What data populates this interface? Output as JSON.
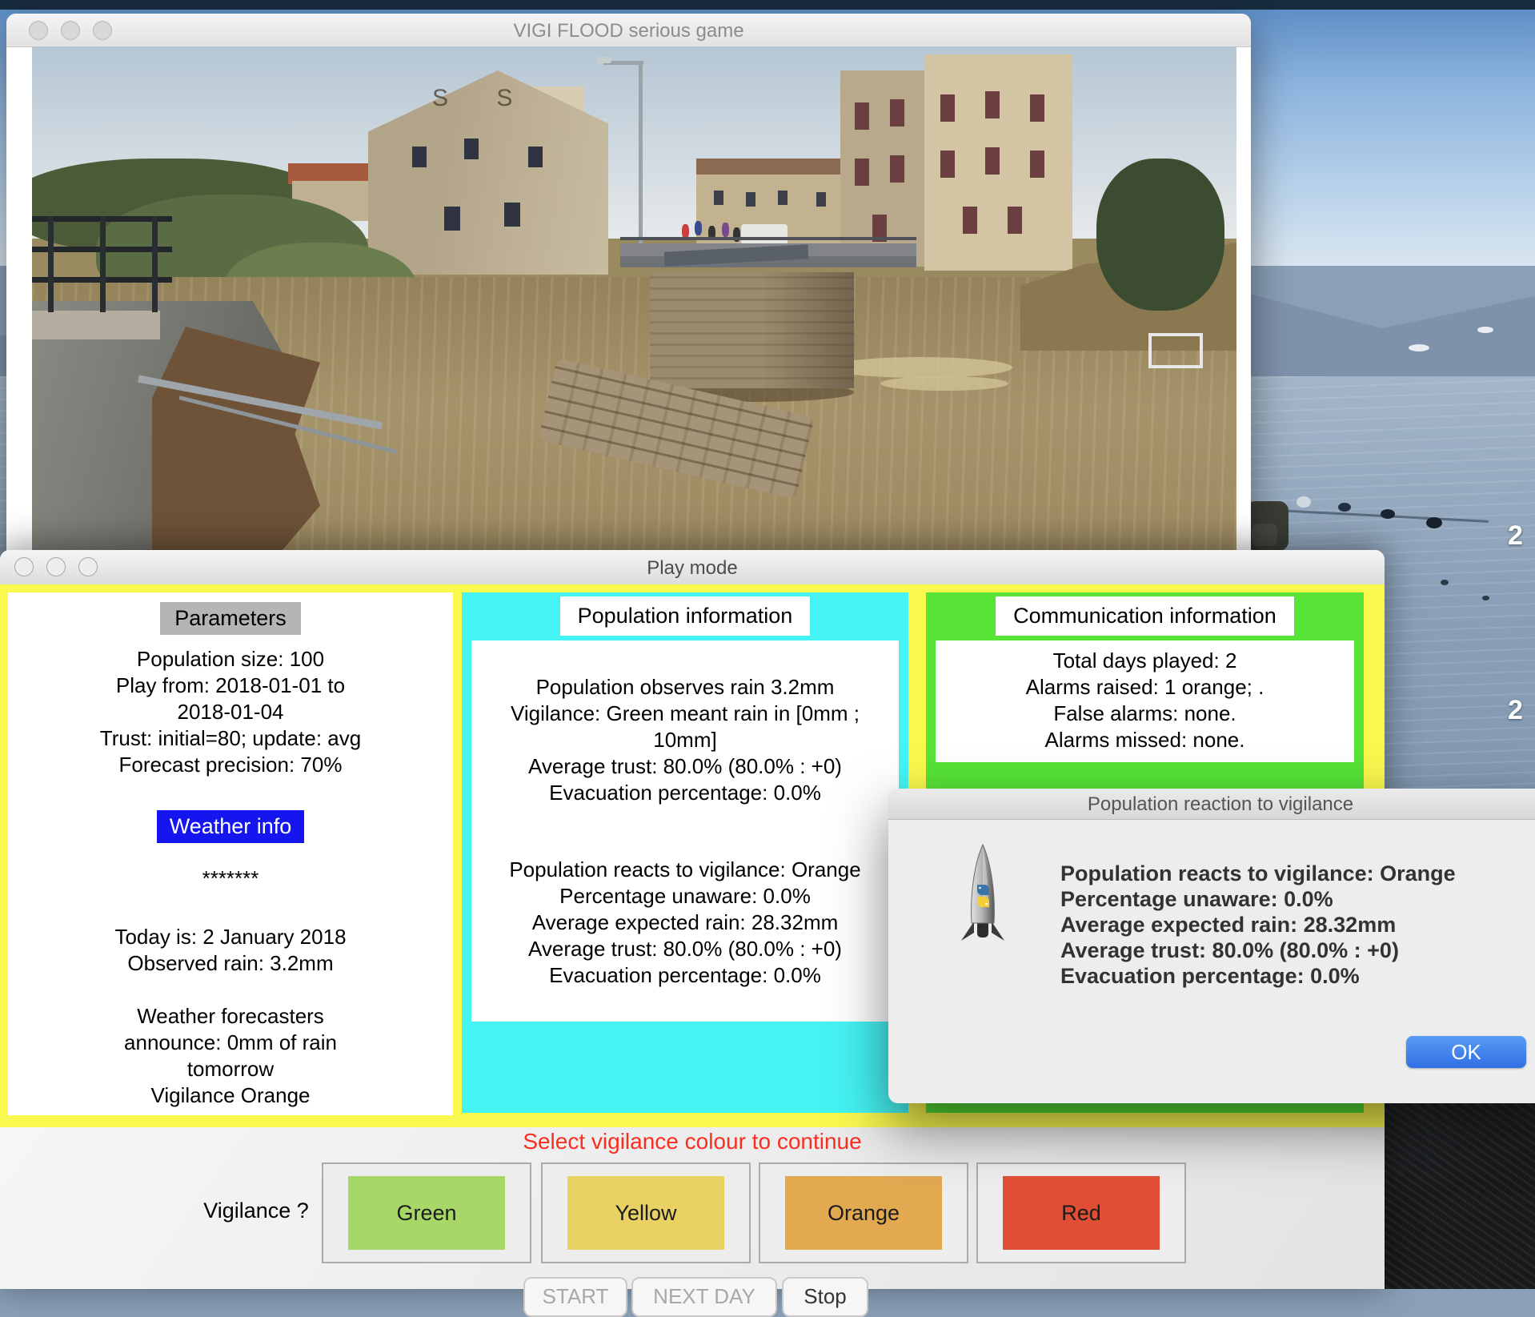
{
  "background": {
    "badge_top": "2",
    "badge_bottom": "2"
  },
  "main_window": {
    "title": "VIGI FLOOD serious game"
  },
  "play_window": {
    "title": "Play mode"
  },
  "parameters_panel": {
    "title": "Parameters",
    "line1": "Population size: 100",
    "line2": "Play from: 2018-01-01 to",
    "line3": "2018-01-04",
    "line4": "Trust: initial=80; update: avg",
    "line5": "Forecast precision: 70%",
    "weather_button": "Weather info",
    "stars": "*******",
    "line6": "Today is: 2 January 2018",
    "line7": "Observed rain: 3.2mm",
    "line8": "Weather forecasters",
    "line9": "announce:  0mm of rain",
    "line10": "tomorrow",
    "line11": "Vigilance Orange"
  },
  "population_panel": {
    "title": "Population information",
    "b1l1": "Population observes rain 3.2mm",
    "b1l2": "Vigilance: Green meant rain in [0mm ;",
    "b1l3": "10mm]",
    "b1l4": "Average trust: 80.0%  (80.0% : +0)",
    "b1l5": "Evacuation percentage: 0.0%",
    "b2l1": "Population reacts to vigilance: Orange",
    "b2l2": "Percentage unaware: 0.0%",
    "b2l3": "Average expected rain: 28.32mm",
    "b2l4": "Average trust: 80.0%  (80.0% : +0)",
    "b2l5": "Evacuation percentage: 0.0%"
  },
  "communication_panel": {
    "title": "Communication information",
    "line1": "Total days played: 2",
    "line2": "Alarms raised: 1 orange; .",
    "line3": "False alarms: none.",
    "line4": "Alarms missed: none."
  },
  "dialog": {
    "title": "Population reaction to vigilance",
    "line1": "Population reacts to vigilance: Orange",
    "line2": "Percentage unaware: 0.0%",
    "line3": "Average expected rain: 28.32mm",
    "line4": "Average trust: 80.0%  (80.0% : +0)",
    "line5": "Evacuation percentage: 0.0%",
    "ok_label": "OK"
  },
  "vigilance": {
    "prompt": "Select vigilance colour to continue",
    "question": "Vigilance ?",
    "green": {
      "label": "Green",
      "color": "#a7d766"
    },
    "yellow": {
      "label": "Yellow",
      "color": "#e9d163"
    },
    "orange": {
      "label": "Orange",
      "color": "#e2a951"
    },
    "red": {
      "label": "Red",
      "color": "#e04f35"
    }
  },
  "controls": {
    "start": "START",
    "next_day": "NEXT DAY",
    "stop": "Stop"
  },
  "colors": {
    "panel_yellow": "#f9f84e",
    "population_cyan": "#45f3f3",
    "communication_green": "#57e437",
    "parameters_label_bg": "#b5b5b5",
    "weather_button_blue": "#1415ef",
    "prompt_red": "#fa2e20",
    "ok_blue": "#2f6fe4"
  }
}
